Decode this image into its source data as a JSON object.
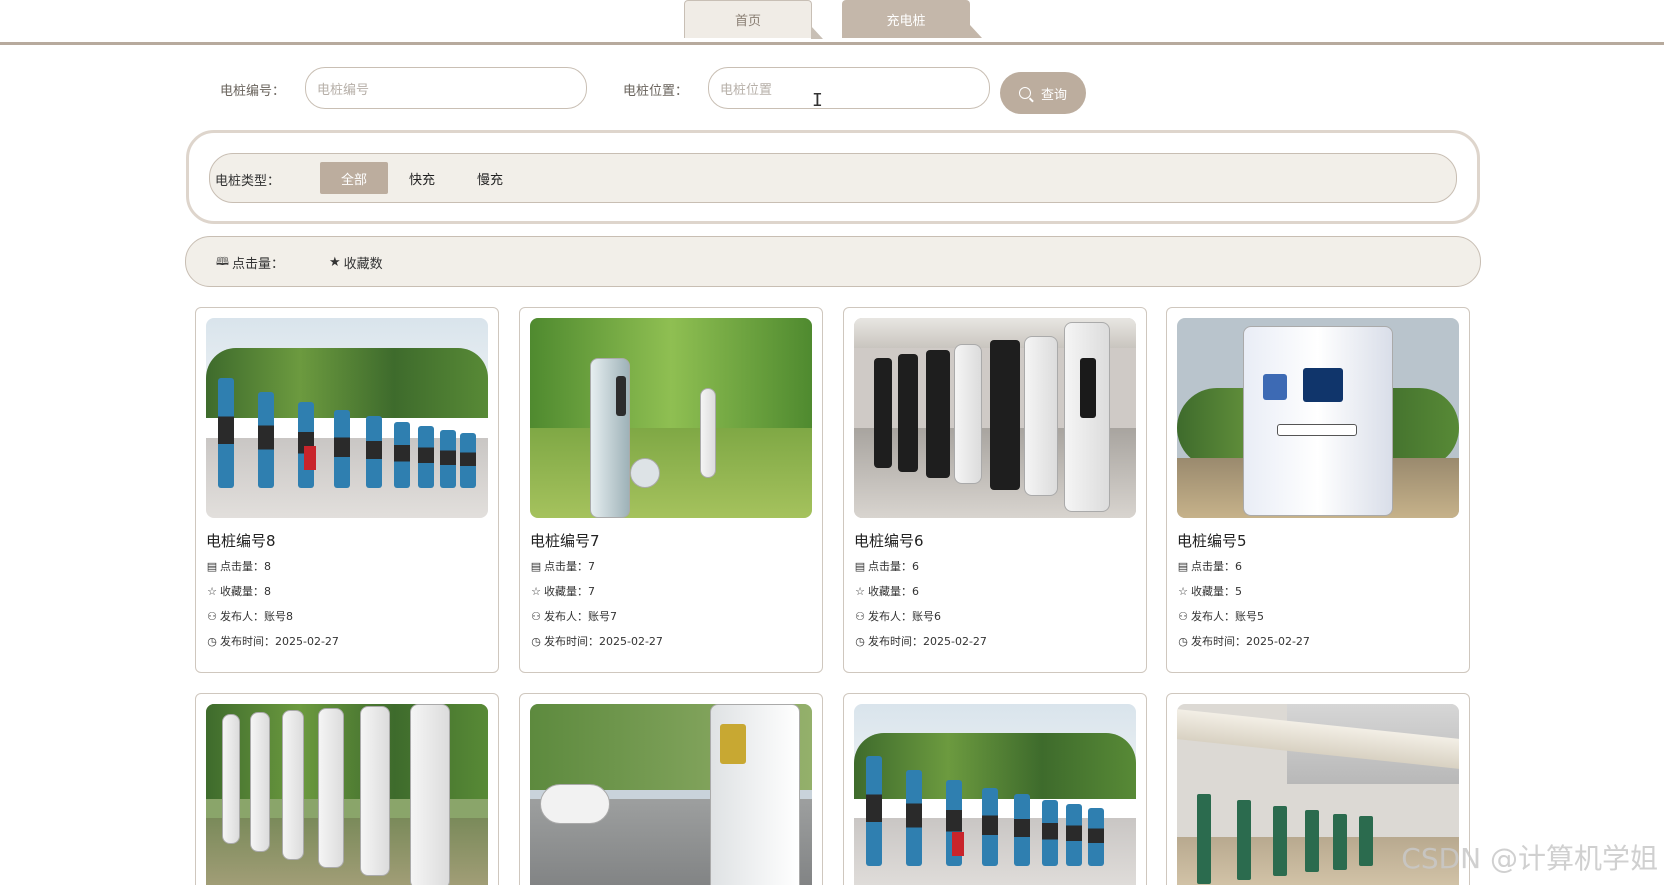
{
  "nav": {
    "tabs": [
      {
        "label": "首页"
      },
      {
        "label": "充电桩"
      }
    ]
  },
  "search": {
    "code_label": "电桩编号：",
    "code_placeholder": "电桩编号",
    "position_label": "电桩位置：",
    "position_placeholder": "电桩位置",
    "query_button": "查询"
  },
  "type_filter": {
    "label": "电桩类型：",
    "options": [
      "全部",
      "快充",
      "慢充"
    ],
    "selected": "全部"
  },
  "sort": {
    "hits": "点击量：",
    "favorites": "收藏数"
  },
  "cards": [
    {
      "title": "电桩编号8",
      "hits": "点击量：8",
      "favs": "收藏量：8",
      "publisher": "发布人：账号8",
      "time": "发布时间：2025-02-27"
    },
    {
      "title": "电桩编号7",
      "hits": "点击量：7",
      "favs": "收藏量：7",
      "publisher": "发布人：账号7",
      "time": "发布时间：2025-02-27"
    },
    {
      "title": "电桩编号6",
      "hits": "点击量：6",
      "favs": "收藏量：6",
      "publisher": "发布人：账号6",
      "time": "发布时间：2025-02-27"
    },
    {
      "title": "电桩编号5",
      "hits": "点击量：6",
      "favs": "收藏量：5",
      "publisher": "发布人：账号5",
      "time": "发布时间：2025-02-27"
    }
  ],
  "watermark": "CSDN @计算机学姐",
  "colors": {
    "accent": "#bcad9e",
    "panel_bg": "#f2efe9",
    "border": "#c8beb3"
  }
}
